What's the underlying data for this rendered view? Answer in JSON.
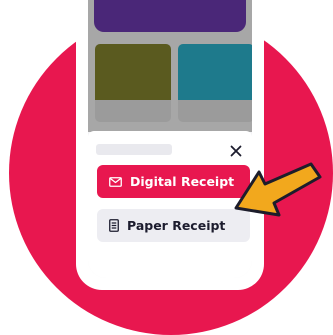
{
  "colors": {
    "circle": "#e8174f",
    "frame": "#ffffff",
    "screen": "#f3f3f6",
    "header": "#4a2778",
    "tile_olive": "#5a5a1f",
    "tile_teal": "#1e7a8c",
    "accent": "#e8174f",
    "arrow_fill": "#f2a81d",
    "arrow_stroke": "#1d1d2b"
  },
  "sheet": {
    "close_icon": "close-icon"
  },
  "buttons": {
    "digital_receipt": {
      "label": "Digital Receipt",
      "icon": "envelope-icon"
    },
    "paper_receipt": {
      "label": "Paper Receipt",
      "icon": "document-icon"
    }
  },
  "callout": {
    "icon": "arrow-icon"
  }
}
